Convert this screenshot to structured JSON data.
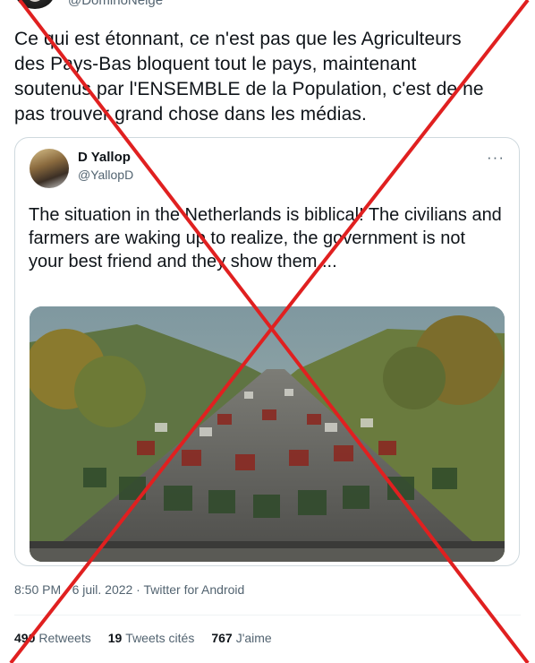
{
  "top": {
    "handle": "@DominoNeige"
  },
  "tweet": {
    "text": "Ce qui est étonnant, ce n'est pas que les Agriculteurs\ndes Pays-Bas bloquent tout le pays, maintenant\nsoutenus par l'ENSEMBLE de la Population, c'est de ne\npas trouver grand chose dans les médias.",
    "meta": "8:50 PM · 6 juil. 2022 · Twitter for Android"
  },
  "quote": {
    "name": "D Yallop",
    "handle": "@YallopD",
    "more": "···",
    "text": "The situation in the Netherlands is biblical! The civilians and farmers are waking up to realize, the government is not your best friend and they show them....",
    "photo_icon": "photo-tractors-highway"
  },
  "stats": {
    "retweets_count": "490",
    "retweets_label": "Retweets",
    "quotes_count": "19",
    "quotes_label": "Tweets cités",
    "likes_count": "767",
    "likes_label": "J'aime"
  },
  "overlay": {
    "cross_color": "#e02020"
  }
}
